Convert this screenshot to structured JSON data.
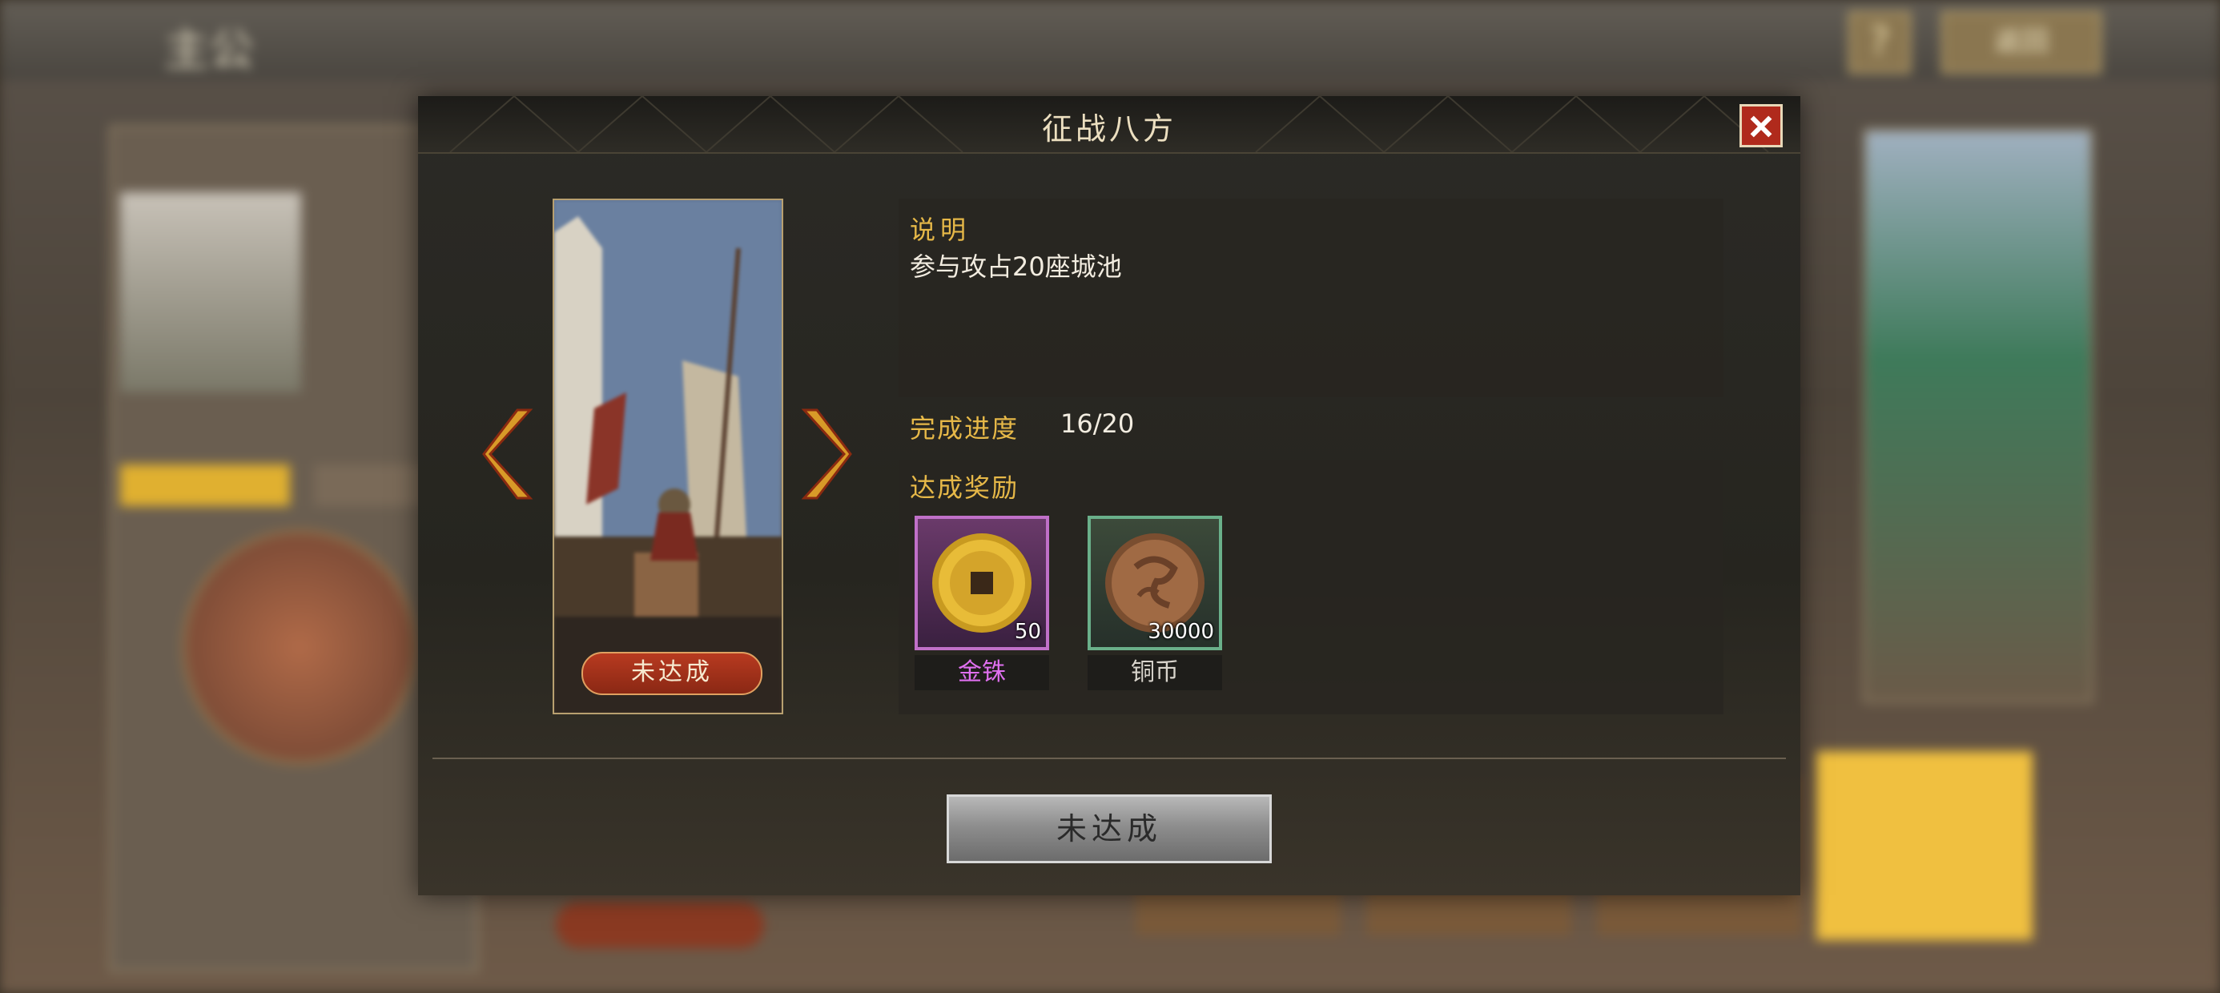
{
  "background": {
    "page_title": "主公",
    "back_label": "返回",
    "help_label": "?"
  },
  "modal": {
    "title": "征战八方",
    "card_status": "未达成",
    "description_heading": "说明",
    "description_text": "参与攻占20座城池",
    "progress_label": "完成进度",
    "progress_value": "16/20",
    "rewards_heading": "达成奖励",
    "rewards": [
      {
        "name": "金铢",
        "count": "50",
        "icon": "gold-coin-icon",
        "rarity_color": "#c070c8"
      },
      {
        "name": "铜币",
        "count": "30000",
        "icon": "copper-coin-icon",
        "rarity_color": "#6ab08a"
      }
    ],
    "bottom_button": "未达成"
  },
  "colors": {
    "accent_gold": "#e6b848",
    "close_red": "#b02a1c",
    "status_red": "#b83a20"
  }
}
